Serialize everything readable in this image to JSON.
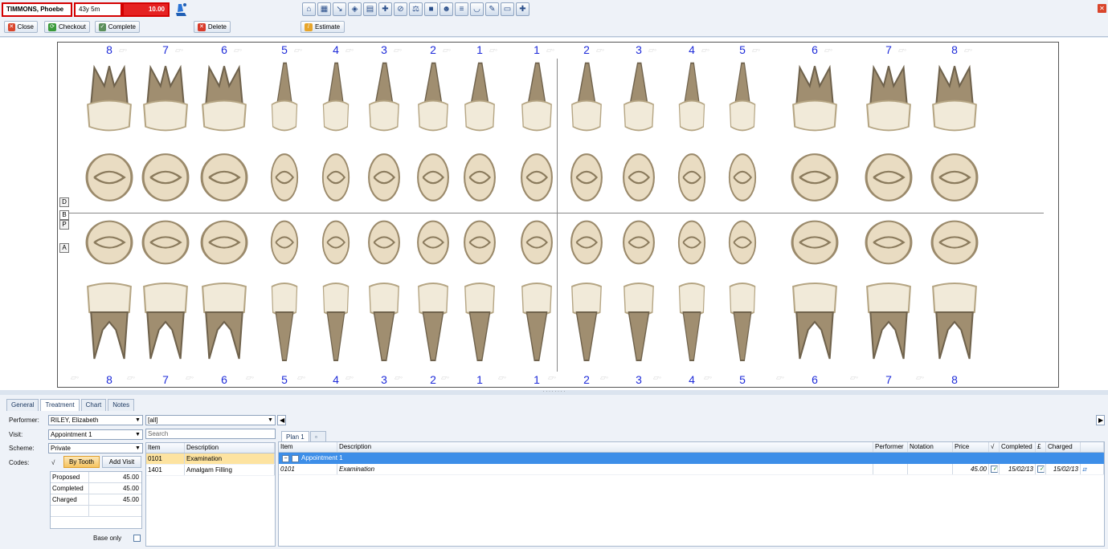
{
  "patient": {
    "name": "TIMMONS, Phoebe",
    "age": "43y 5m",
    "balance": "10.00"
  },
  "toolbar": {
    "close": "Close",
    "checkout": "Checkout",
    "complete": "Complete",
    "delete": "Delete",
    "estimate": "Estimate"
  },
  "chart": {
    "upper_numbers": [
      "8",
      "7",
      "6",
      "5",
      "4",
      "3",
      "2",
      "1",
      "1",
      "2",
      "3",
      "4",
      "5",
      "6",
      "7",
      "8"
    ],
    "lower_numbers": [
      "8",
      "7",
      "6",
      "5",
      "4",
      "3",
      "2",
      "1",
      "1",
      "2",
      "3",
      "4",
      "5",
      "6",
      "7",
      "8"
    ],
    "side_buttons": [
      "D",
      "B",
      "P",
      "A"
    ]
  },
  "tabs": [
    "General",
    "Treatment",
    "Chart",
    "Notes"
  ],
  "form": {
    "performer_label": "Performer:",
    "performer": "RILEY, Elizabeth",
    "visit_label": "Visit:",
    "visit": "Appointment 1",
    "scheme_label": "Scheme:",
    "scheme": "Private",
    "codes_label": "Codes:",
    "codes_check": "√",
    "by_tooth": "By Tooth",
    "add_visit": "Add Visit",
    "filter": "[all]",
    "search": "Search",
    "base_only": "Base only"
  },
  "totals": [
    {
      "label": "Proposed",
      "value": "45.00"
    },
    {
      "label": "Completed",
      "value": "45.00"
    },
    {
      "label": "Charged",
      "value": "45.00"
    }
  ],
  "codes": {
    "headers": [
      "Item",
      "Description"
    ],
    "rows": [
      {
        "item": "0101",
        "desc": "Examination"
      },
      {
        "item": "1401",
        "desc": "Amalgam Filling"
      }
    ]
  },
  "plan": {
    "tab": "Plan 1",
    "headers": [
      "Item",
      "Description",
      "Performer",
      "Notation",
      "Price",
      "√",
      "Completed",
      "£",
      "Charged"
    ],
    "group": "Appointment 1",
    "rows": [
      {
        "item": "0101",
        "desc": "Examination",
        "performer": "",
        "notation": "",
        "price": "45.00",
        "completed": "15/02/13",
        "charged": "15/02/13"
      }
    ]
  }
}
